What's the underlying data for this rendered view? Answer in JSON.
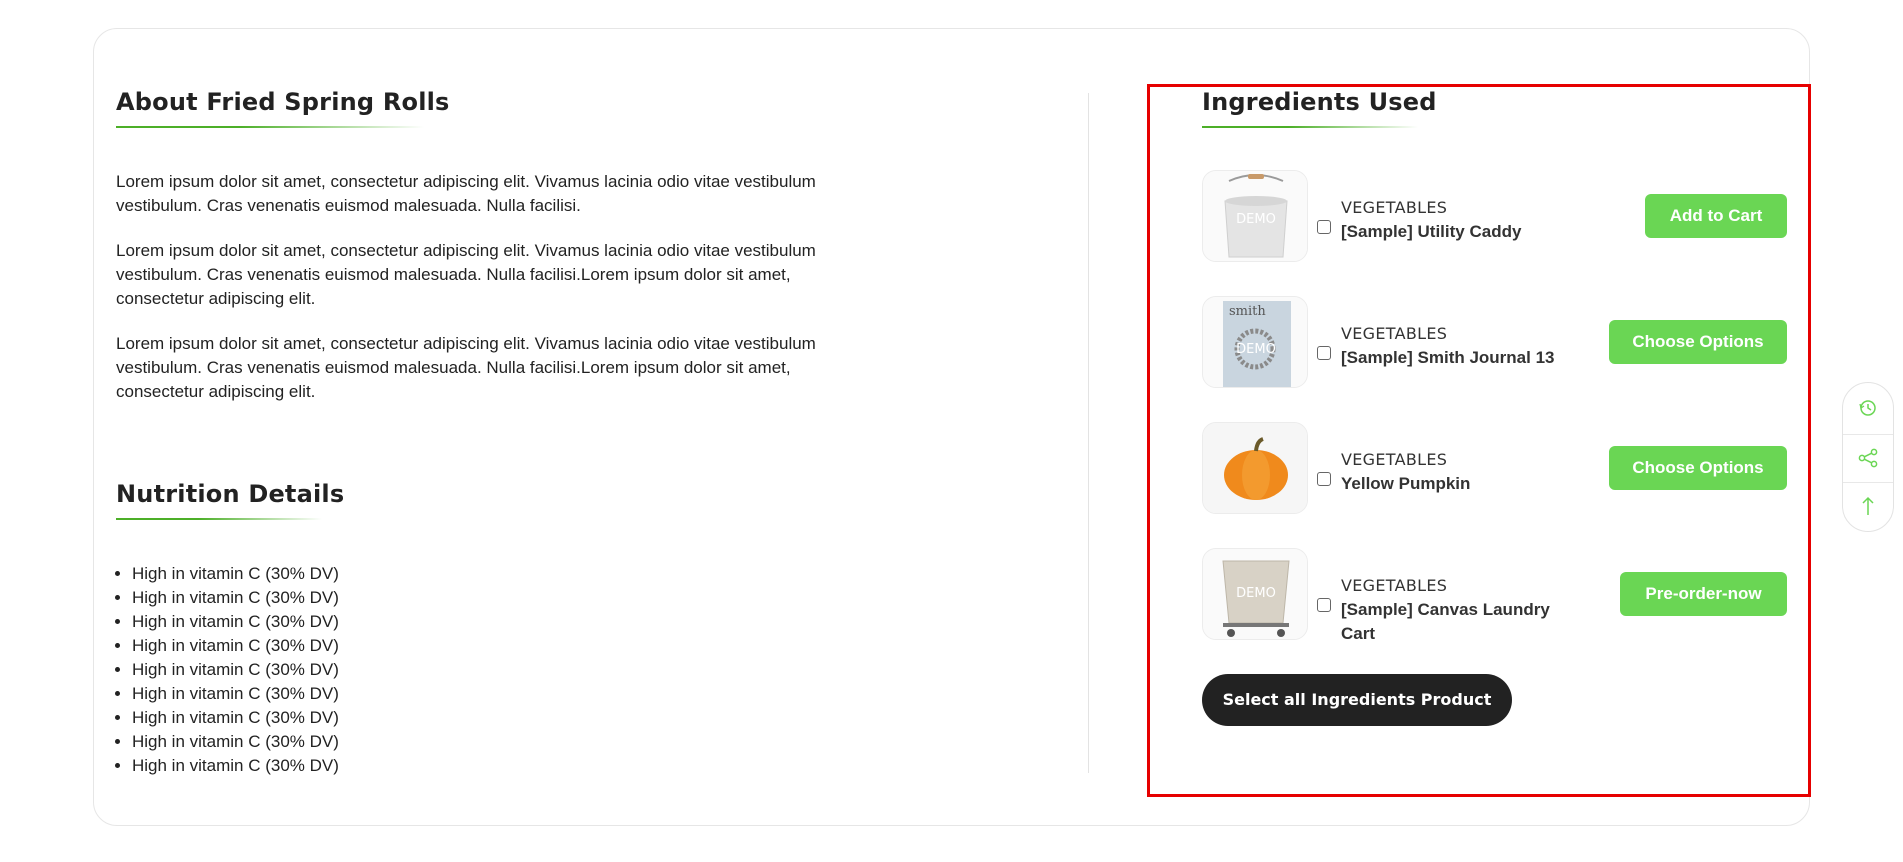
{
  "about": {
    "title": "About Fried Spring Rolls",
    "paragraphs": [
      "Lorem ipsum dolor sit amet, consectetur adipiscing elit. Vivamus lacinia odio vitae vestibulum vestibulum. Cras venenatis euismod malesuada. Nulla facilisi.",
      "Lorem ipsum dolor sit amet, consectetur adipiscing elit. Vivamus lacinia odio vitae vestibulum vestibulum. Cras venenatis euismod malesuada. Nulla facilisi.Lorem ipsum dolor sit amet, consectetur adipiscing elit.",
      "Lorem ipsum dolor sit amet, consectetur adipiscing elit. Vivamus lacinia odio vitae vestibulum vestibulum. Cras venenatis euismod malesuada. Nulla facilisi.Lorem ipsum dolor sit amet, consectetur adipiscing elit."
    ]
  },
  "nutrition": {
    "title": "Nutrition Details",
    "items": [
      "High in vitamin C (30% DV)",
      "High in vitamin C (30% DV)",
      "High in vitamin C (30% DV)",
      "High in vitamin C (30% DV)",
      "High in vitamin C (30% DV)",
      "High in vitamin C (30% DV)",
      "High in vitamin C (30% DV)",
      "High in vitamin C (30% DV)",
      "High in vitamin C (30% DV)"
    ]
  },
  "ingredients": {
    "title": "Ingredients Used",
    "items": [
      {
        "category": "VEGETABLES",
        "name": "[Sample] Utility Caddy",
        "button": "Add to Cart",
        "image": "bucket-image",
        "watermark": "DEMO"
      },
      {
        "category": "VEGETABLES",
        "name": "[Sample] Smith Journal 13",
        "button": "Choose Options",
        "image": "journal-image",
        "watermark": "DEMO",
        "cover_text": "smith"
      },
      {
        "category": "VEGETABLES",
        "name": "Yellow Pumpkin",
        "button": "Choose Options",
        "image": "pumpkin-image"
      },
      {
        "category": "VEGETABLES",
        "name": "[Sample] Canvas Laundry Cart",
        "button": "Pre-order-now",
        "image": "laundry-cart-image",
        "watermark": "DEMO"
      }
    ],
    "select_all_label": "Select all Ingredients Product"
  },
  "side_tools": [
    "history-icon",
    "share-icon",
    "arrow-up-icon"
  ],
  "colors": {
    "accent": "#6ad654",
    "highlight_border": "#e60000",
    "dark_button": "#222222"
  }
}
